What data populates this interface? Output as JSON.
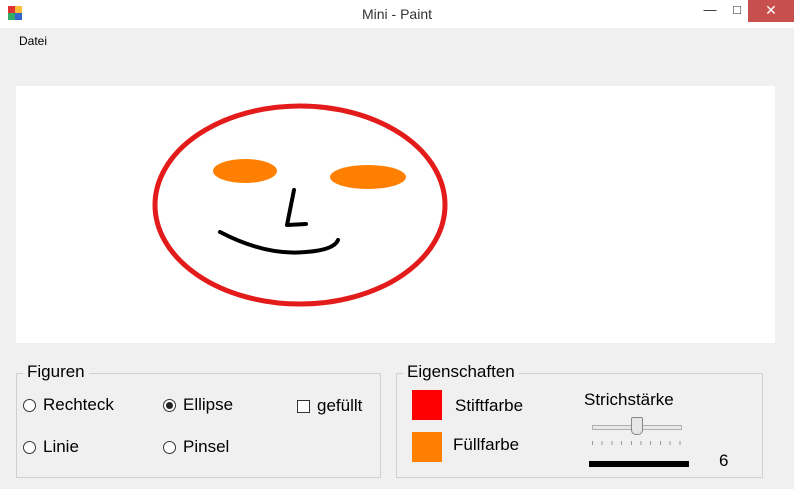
{
  "window": {
    "title": "Mini - Paint",
    "min_glyph": "—",
    "max_glyph": "□",
    "close_glyph": "✕"
  },
  "menu": {
    "items": [
      {
        "label": "Datei"
      }
    ]
  },
  "canvas": {
    "background": "#ffffff",
    "drawing": "smiley face: red ellipse, two orange filled ellipse eyes, black nose and mouth strokes"
  },
  "figuren": {
    "title": "Figuren",
    "options": [
      {
        "label": "Rechteck",
        "selected": false
      },
      {
        "label": "Ellipse",
        "selected": true
      },
      {
        "label": "Linie",
        "selected": false
      },
      {
        "label": "Pinsel",
        "selected": false
      }
    ],
    "filled": {
      "label": "gefüllt",
      "checked": false
    }
  },
  "eigenschaften": {
    "title": "Eigenschaften",
    "pen_color": {
      "label": "Stiftfarbe",
      "color": "#ff0000"
    },
    "fill_color": {
      "label": "Füllfarbe",
      "color": "#ff8000"
    },
    "stroke": {
      "label": "Strichstärke",
      "value": "6",
      "slider_fraction": 0.5
    }
  }
}
